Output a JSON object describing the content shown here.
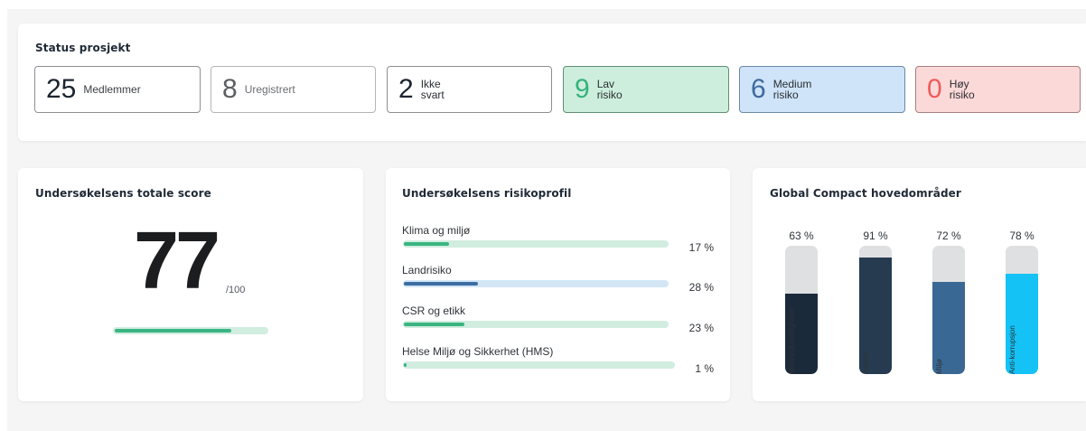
{
  "status": {
    "title": "Status prosjekt",
    "items": [
      {
        "value": "25",
        "label": "Medlemmer"
      },
      {
        "value": "8",
        "label": "Uregistrert"
      },
      {
        "value": "2",
        "label": "Ikke\nsvart"
      },
      {
        "value": "9",
        "label": "Lav\nrisiko"
      },
      {
        "value": "6",
        "label": "Medium\nrisiko"
      },
      {
        "value": "0",
        "label": "Høy\nrisiko"
      }
    ]
  },
  "score": {
    "title": "Undersøkelsens totale score",
    "value": "77",
    "max_label": "/100",
    "fraction": 0.77
  },
  "risk": {
    "title": "Undersøkelsens risikoprofil",
    "items": [
      {
        "label": "Klima og miljø",
        "pct_label": "17 %",
        "value": 17,
        "color": "green"
      },
      {
        "label": "Landrisiko",
        "pct_label": "28 %",
        "value": 28,
        "color": "blue"
      },
      {
        "label": "CSR og etikk",
        "pct_label": "23 %",
        "value": 23,
        "color": "green"
      },
      {
        "label": "Helse Miljø og Sikkerhet (HMS)",
        "pct_label": "1 %",
        "value": 1,
        "color": "green"
      }
    ]
  },
  "global_compact": {
    "title": "Global Compact hovedområder",
    "items": [
      {
        "label": "Menneskerettigheter",
        "pct_label": "63 %",
        "value": 63,
        "color": "#1b2a3b"
      },
      {
        "label": "Arbeid",
        "pct_label": "91 %",
        "value": 91,
        "color": "#263b50"
      },
      {
        "label": "Miljø",
        "pct_label": "72 %",
        "value": 72,
        "color": "#3a6894"
      },
      {
        "label": "Anti-korrupsjon",
        "pct_label": "78 %",
        "value": 78,
        "color": "#14c2f5"
      }
    ]
  }
}
